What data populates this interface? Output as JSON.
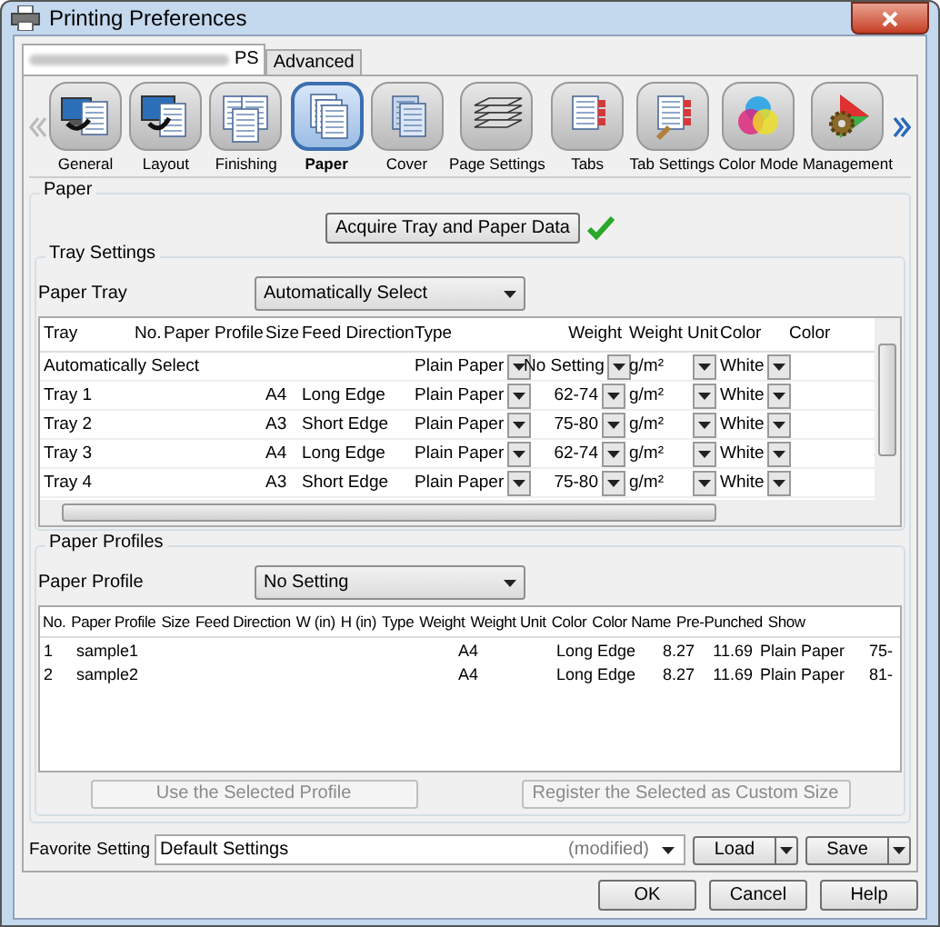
{
  "window": {
    "title": "Printing Preferences"
  },
  "tabs": [
    {
      "label": "PS",
      "selected": true
    },
    {
      "label": "Advanced",
      "selected": false
    }
  ],
  "categories": [
    {
      "label": "General",
      "selected": false
    },
    {
      "label": "Layout",
      "selected": false
    },
    {
      "label": "Finishing",
      "selected": false
    },
    {
      "label": "Paper",
      "selected": true
    },
    {
      "label": "Cover",
      "selected": false
    },
    {
      "label": "Page Settings",
      "selected": false
    },
    {
      "label": "Tabs",
      "selected": false
    },
    {
      "label": "Tab Settings",
      "selected": false
    },
    {
      "label": "Color Mode",
      "selected": false
    },
    {
      "label": "Management",
      "selected": false
    }
  ],
  "paper": {
    "title": "Paper",
    "acquire_button": "Acquire Tray and Paper Data",
    "acquired": true,
    "tray_settings": {
      "title": "Tray Settings",
      "paper_tray_label": "Paper Tray",
      "paper_tray_value": "Automatically Select",
      "table": {
        "columns": [
          "Tray",
          "No.",
          "Paper Profile",
          "Size",
          "Feed Direction",
          "Type",
          "Weight",
          "Weight Unit",
          "Color",
          "Color"
        ],
        "rows": [
          {
            "tray": "Automatically Select",
            "type": "Plain Paper",
            "weight": "No Setting",
            "weight_unit": "g/m²",
            "paper_color": "White"
          },
          {
            "tray": "Tray 1",
            "size": "A4",
            "feed_direction": "Long Edge",
            "type": "Plain Paper",
            "weight": "62-74",
            "weight_unit": "g/m²",
            "paper_color": "White"
          },
          {
            "tray": "Tray 2",
            "size": "A3",
            "feed_direction": "Short Edge",
            "type": "Plain Paper",
            "weight": "75-80",
            "weight_unit": "g/m²",
            "paper_color": "White"
          },
          {
            "tray": "Tray 3",
            "size": "A4",
            "feed_direction": "Long Edge",
            "type": "Plain Paper",
            "weight": "62-74",
            "weight_unit": "g/m²",
            "paper_color": "White"
          },
          {
            "tray": "Tray 4",
            "size": "A3",
            "feed_direction": "Short Edge",
            "type": "Plain Paper",
            "weight": "75-80",
            "weight_unit": "g/m²",
            "paper_color": "White"
          }
        ]
      }
    },
    "paper_profiles": {
      "title": "Paper Profiles",
      "label": "Paper Profile",
      "value": "No Setting",
      "table": {
        "columns": [
          "No.",
          "Paper Profile",
          "Size",
          "Feed Direction",
          "W (in)",
          "H (in)",
          "Type",
          "Weight",
          "Weight Unit",
          "Color",
          "Color Name",
          "Pre-Punched",
          "Show"
        ],
        "rows": [
          {
            "cells": [
              "1",
              "sample1",
              "A4",
              "Long Edge",
              "8.27",
              "11.69",
              "Plain Paper",
              "75-"
            ]
          },
          {
            "cells": [
              "2",
              "sample2",
              "A4",
              "Long Edge",
              "8.27",
              "11.69",
              "Plain Paper",
              "81-"
            ]
          }
        ]
      },
      "buttons": [
        {
          "label": "Use the Selected Profile",
          "disabled": true
        },
        {
          "label": "Register the Selected as Custom Size",
          "disabled": true
        }
      ]
    }
  },
  "favorite": {
    "label": "Favorite Setting",
    "value": "Default Settings",
    "status": "(modified)",
    "buttons": [
      "Load",
      "Save"
    ]
  },
  "dialog_buttons": [
    "OK",
    "Cancel",
    "Help"
  ]
}
